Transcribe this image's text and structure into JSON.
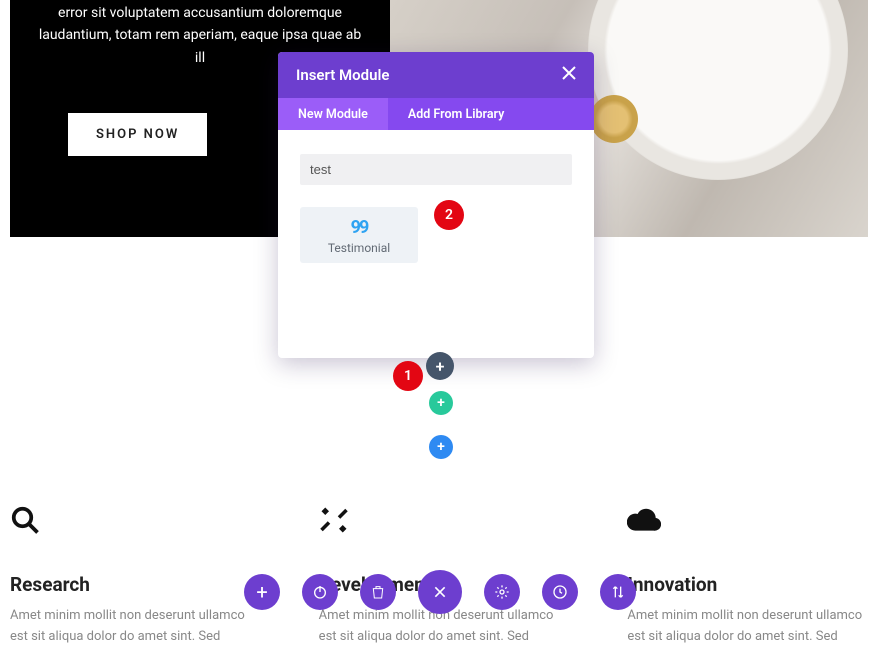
{
  "hero": {
    "text": "error sit voluptatem accusantium doloremque laudantium, totam rem aperiam, eaque ipsa quae ab ill",
    "button_label": "SHOP NOW"
  },
  "modal": {
    "title": "Insert Module",
    "tabs": {
      "new": "New Module",
      "library": "Add From Library"
    },
    "search_value": "test",
    "module": {
      "icon_name": "quote-icon",
      "label": "Testimonial"
    }
  },
  "badges": {
    "one": "1",
    "two": "2"
  },
  "add_buttons": {
    "slate": "+",
    "teal": "+",
    "blue": "+"
  },
  "features": [
    {
      "icon": "search",
      "icon_name": "search-icon",
      "title": "Research",
      "text": "Amet minim mollit non deserunt ullamco est sit aliqua dolor do amet sint. Sed"
    },
    {
      "icon": "tools",
      "icon_name": "tools-icon",
      "title": "Development",
      "text": "Amet minim mollit non deserunt ullamco est sit aliqua dolor do amet sint. Sed"
    },
    {
      "icon": "cloud",
      "icon_name": "cloud-icon",
      "title": "Innovation",
      "text": "Amet minim mollit non deserunt ullamco est sit aliqua dolor do amet sint. Sed"
    }
  ],
  "page_controls": {
    "add": {
      "name": "add-button",
      "label": "+"
    },
    "power": {
      "name": "power-button"
    },
    "delete": {
      "name": "delete-button"
    },
    "close": {
      "name": "close-button"
    },
    "settings": {
      "name": "settings-button"
    },
    "history": {
      "name": "history-button"
    },
    "sort": {
      "name": "sort-button"
    }
  }
}
